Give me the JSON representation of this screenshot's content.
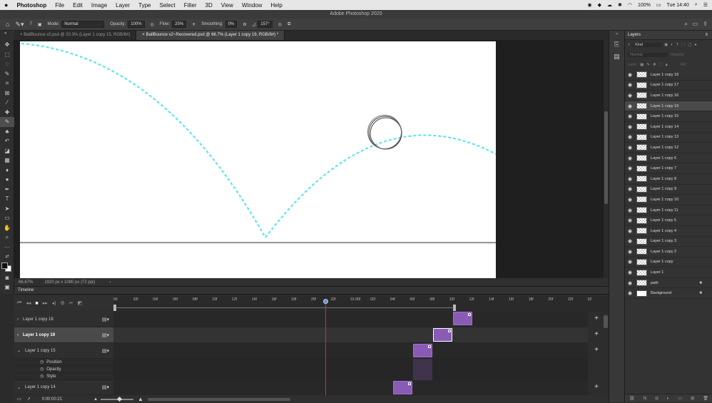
{
  "menubar": {
    "apple": "",
    "items": [
      "Photoshop",
      "File",
      "Edit",
      "Image",
      "Layer",
      "Type",
      "Select",
      "Filter",
      "3D",
      "View",
      "Window",
      "Help"
    ],
    "battery": "100%",
    "clock": "Tue 14:40"
  },
  "titlebar": {
    "title": "Adobe Photoshop 2020"
  },
  "options": {
    "mode_label": "Mode:",
    "mode_value": "Normal",
    "opacity_label": "Opacity:",
    "opacity_value": "100%",
    "flow_label": "Flow:",
    "flow_value": "25%",
    "smoothing_label": "Smoothing:",
    "smoothing_value": "0%",
    "angle_value": "157°",
    "brush_size": "7"
  },
  "tabs": [
    {
      "label": "BallBounce v2.psd @ 33.3% (Layer 1 copy 15, RGB/8#)"
    },
    {
      "label": "BallBounce v2~Recovered.psd @ 66.7% (Layer 1 copy 19, RGB/8#) *"
    }
  ],
  "status": {
    "zoom": "66.67%",
    "doc_info": "1920 px x 1080 px (72 ppi)"
  },
  "timeline": {
    "title": "Timeline",
    "timecode": "0:00:00:21",
    "ruler_ticks": [
      "00",
      "02f",
      "04f",
      "06f",
      "08f",
      "10f",
      "12f",
      "14f",
      "16f",
      "18f",
      "20f",
      "22f",
      "01:00f",
      "02f",
      "04f",
      "06f",
      "08f",
      "10f",
      "12f",
      "14f",
      "16f",
      "18f",
      "20f",
      "22f",
      "02"
    ],
    "tracks": [
      {
        "name": "Layer 1 copy 18",
        "selected": false,
        "frame": 19
      },
      {
        "name": "Layer 1 copy 19",
        "selected": true,
        "frame": 18
      },
      {
        "name": "Layer 1 copy 15",
        "selected": false,
        "frame": 17
      },
      {
        "name": "Layer 1 copy 14",
        "selected": false,
        "frame": 16
      }
    ],
    "properties": [
      "Position",
      "Opacity",
      "Style"
    ]
  },
  "layers_panel": {
    "title": "Layers",
    "kind": "Kind",
    "blend": "Normal",
    "opacity_label": "Opacity:",
    "lock_label": "Lock:",
    "fill_label": "Fill:",
    "layers": [
      {
        "name": "Layer 1 copy 18",
        "selected": false,
        "locked": false
      },
      {
        "name": "Layer 1 copy 17",
        "selected": false,
        "locked": false
      },
      {
        "name": "Layer 1 copy 16",
        "selected": false,
        "locked": false
      },
      {
        "name": "Layer 1 copy 19",
        "selected": true,
        "locked": false
      },
      {
        "name": "Layer 1 copy 15",
        "selected": false,
        "locked": false
      },
      {
        "name": "Layer 1 copy 14",
        "selected": false,
        "locked": false
      },
      {
        "name": "Layer 1 copy 13",
        "selected": false,
        "locked": false
      },
      {
        "name": "Layer 1 copy 12",
        "selected": false,
        "locked": false
      },
      {
        "name": "Layer 1 copy 6",
        "selected": false,
        "locked": false
      },
      {
        "name": "Layer 1 copy 7",
        "selected": false,
        "locked": false
      },
      {
        "name": "Layer 1 copy 8",
        "selected": false,
        "locked": false
      },
      {
        "name": "Layer 1 copy 9",
        "selected": false,
        "locked": false
      },
      {
        "name": "Layer 1 copy 10",
        "selected": false,
        "locked": false
      },
      {
        "name": "Layer 1 copy 11",
        "selected": false,
        "locked": false
      },
      {
        "name": "Layer 1 copy 5",
        "selected": false,
        "locked": false
      },
      {
        "name": "Layer 1 copy 4",
        "selected": false,
        "locked": false
      },
      {
        "name": "Layer 1 copy 3",
        "selected": false,
        "locked": false
      },
      {
        "name": "Layer 1 copy 2",
        "selected": false,
        "locked": false
      },
      {
        "name": "Layer 1 copy",
        "selected": false,
        "locked": false
      },
      {
        "name": "Layer 1",
        "selected": false,
        "locked": false
      },
      {
        "name": "path",
        "selected": false,
        "locked": true
      },
      {
        "name": "Background",
        "selected": false,
        "locked": true,
        "white": true
      }
    ]
  },
  "colors": {
    "accent": "#0a84ff",
    "clip": "#8a5bb5",
    "path": "#5ee6ee",
    "playhead": "#d03030"
  }
}
